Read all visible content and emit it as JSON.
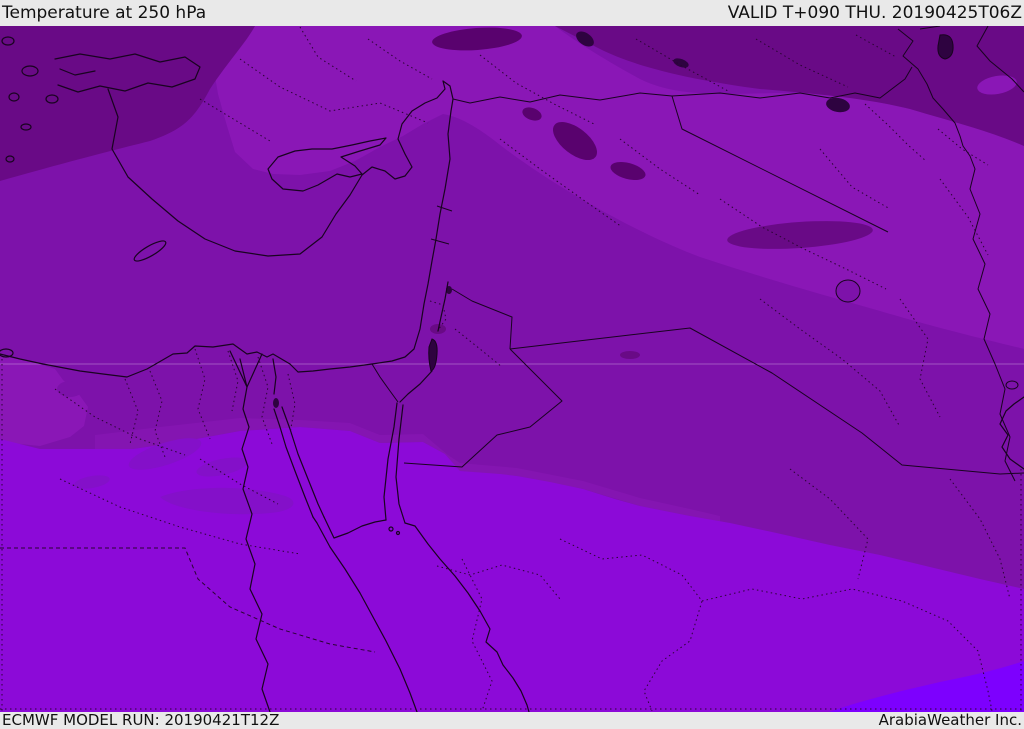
{
  "header": {
    "title": "Temperature at 250 hPa",
    "valid_label": "VALID T+090 THU. 20190425T06Z"
  },
  "footer": {
    "model_run": "ECMWF MODEL RUN: 20190421T12Z",
    "attribution": "ArabiaWeather Inc."
  },
  "map": {
    "parameter": "Temperature",
    "level": "250 hPa",
    "model": "ECMWF",
    "valid_time": "20190425T06Z",
    "run_time": "20190421T12Z",
    "forecast_hour": "T+090",
    "colors": {
      "xdark": "#59026e",
      "dark": "#690a86",
      "mid": "#7d12aa",
      "light": "#8a17b6",
      "bright": "#8c0ad8",
      "brightest": "#7d00fe",
      "smudge": "#8410c9",
      "lake": "#2e0340",
      "bar_bg": "#e9e9e9",
      "bar_text": "#111111"
    },
    "temperature_shades_cold_to_warm": [
      "#59026e",
      "#690a86",
      "#7d12aa",
      "#8a17b6",
      "#8c0ad8",
      "#7d00fe"
    ]
  }
}
